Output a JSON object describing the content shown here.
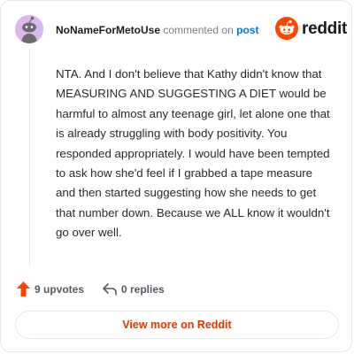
{
  "header": {
    "username": "NoNameForMetoUse",
    "commented_on": "commented on",
    "post_link": "post",
    "brand": "reddit"
  },
  "comment": {
    "text": "NTA. And I don't believe that Kathy didn't know that MEASURING AND SUGGESTING A DIET would be harmful to almost any teenage girl, let alone one that is already struggling with body positivity. You responded appropriately. I would have been tempted to ask how she'd feel if I grabbed a tape measure and then started suggesting how she needs to get that number down. Because we ALL know it wouldn't go over well."
  },
  "actions": {
    "upvotes_label": "9 upvotes",
    "replies_label": "0 replies"
  },
  "cta": {
    "label": "View more on Reddit"
  },
  "icons": {
    "avatar": "snoo-avatar-icon",
    "brand": "reddit-logo-icon",
    "upvote": "upvote-arrow-icon",
    "reply": "reply-arrow-icon"
  },
  "colors": {
    "brand_orange": "#ff4500",
    "link_blue": "#0079d3",
    "avatar_bg": "#d7b8f0",
    "cta_text": "#d93a00"
  }
}
